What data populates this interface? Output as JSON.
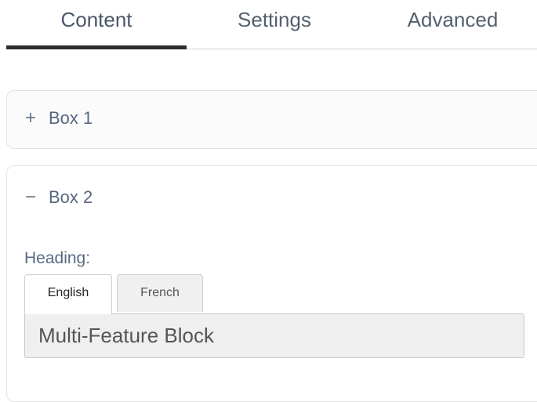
{
  "tabs": [
    {
      "label": "Content",
      "active": true
    },
    {
      "label": "Settings",
      "active": false
    },
    {
      "label": "Advanced",
      "active": false
    }
  ],
  "panels": [
    {
      "sign": "+",
      "title": "Box 1",
      "expanded": false
    },
    {
      "sign": "−",
      "title": "Box 2",
      "expanded": true
    }
  ],
  "box2": {
    "heading_label": "Heading:",
    "languages": [
      "English",
      "French"
    ],
    "active_language": "English",
    "heading_value": "Multi-Feature Block"
  },
  "colors": {
    "active_tab_underline": "#2c2c2c",
    "label_text": "#5a6a85"
  }
}
